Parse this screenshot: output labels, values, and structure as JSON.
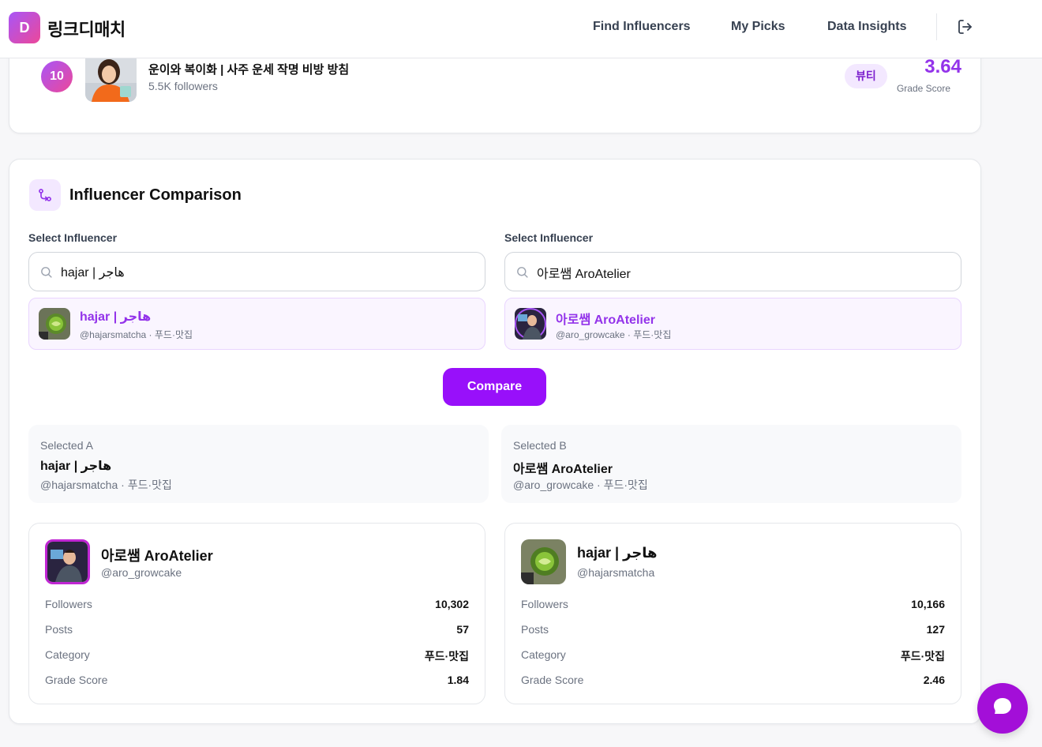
{
  "header": {
    "logo_letter": "D",
    "app_name": "링크디매치",
    "nav": [
      "Find Influencers",
      "My Picks",
      "Data Insights"
    ]
  },
  "ranking_item": {
    "rank": "10",
    "name": "운이와 복이화 | 사주 운세 작명 비방 방침",
    "followers": "5.5K followers",
    "tag": "뷰티",
    "score": "3.64",
    "score_label": "Grade Score"
  },
  "comparison": {
    "title": "Influencer Comparison",
    "select_label_a": "Select Influencer",
    "select_label_b": "Select Influencer",
    "search_a_value": "hajar | هاجر",
    "search_b_value": "아로쌤 AroAtelier",
    "result_a": {
      "name": "hajar | هاجر",
      "meta": "@hajarsmatcha · 푸드·맛집"
    },
    "result_b": {
      "name": "아로쌤 AroAtelier",
      "meta": "@aro_growcake · 푸드·맛집"
    },
    "compare_button": "Compare",
    "selected_a": {
      "label": "Selected A",
      "name": "hajar | هاجر",
      "meta": "@hajarsmatcha · 푸드·맛집"
    },
    "selected_b": {
      "label": "Selected B",
      "name": "아로쌤 AroAtelier",
      "meta": "@aro_growcake · 푸드·맛집"
    },
    "card_left": {
      "name": "아로쌤 AroAtelier",
      "handle": "@aro_growcake",
      "stats": [
        {
          "key": "Followers",
          "value": "10,302"
        },
        {
          "key": "Posts",
          "value": "57"
        },
        {
          "key": "Category",
          "value": "푸드·맛집"
        },
        {
          "key": "Grade Score",
          "value": "1.84"
        }
      ]
    },
    "card_right": {
      "name": "hajar | هاجر",
      "handle": "@hajarsmatcha",
      "stats": [
        {
          "key": "Followers",
          "value": "10,166"
        },
        {
          "key": "Posts",
          "value": "127"
        },
        {
          "key": "Category",
          "value": "푸드·맛집"
        },
        {
          "key": "Grade Score",
          "value": "2.46"
        }
      ]
    }
  },
  "colors": {
    "accent": "#9810fa",
    "accent_light": "#f3e8ff",
    "brand_gradient_start": "#a855f7",
    "brand_gradient_end": "#ec4899"
  },
  "icons": [
    "logout-icon",
    "compare-icon",
    "search-icon",
    "chat-icon"
  ]
}
